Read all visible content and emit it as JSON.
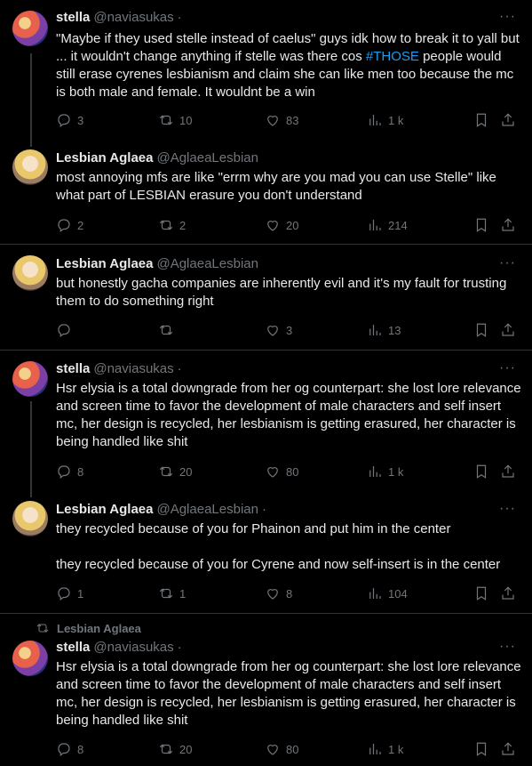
{
  "tweets": [
    {
      "name": "stella",
      "handle": "@naviasukas",
      "text_before": "\"Maybe if they used stelle instead of caelus\" guys idk how to break it to yall but ... it wouldn't change anything if stelle was there cos ",
      "hashtag": "#THOSE",
      "text_after": " people would still erase cyrenes lesbianism and claim she can like men too because the mc is both male and female. It wouldnt be a win",
      "replies": "3",
      "reposts": "10",
      "likes": "83",
      "views": "1 k"
    },
    {
      "name": "Lesbian Aglaea",
      "handle": "@AglaeaLesbian",
      "text": "most annoying mfs are like \"errm why are you mad you can use Stelle\" like what part of LESBIAN erasure you don't understand",
      "replies": "2",
      "reposts": "2",
      "likes": "20",
      "views": "214"
    },
    {
      "name": "Lesbian Aglaea",
      "handle": "@AglaeaLesbian",
      "text": "but honestly gacha companies are inherently evil and it's my fault for trusting them to do something right",
      "replies": "",
      "reposts": "",
      "likes": "3",
      "views": "13"
    },
    {
      "name": "stella",
      "handle": "@naviasukas",
      "text": "Hsr elysia is a total downgrade from her og counterpart: she lost lore relevance and screen time to favor the development of male characters and self insert mc, her design is recycled, her lesbianism is getting erasured, her character is being handled like shit",
      "replies": "8",
      "reposts": "20",
      "likes": "80",
      "views": "1 k"
    },
    {
      "name": "Lesbian Aglaea",
      "handle": "@AglaeaLesbian",
      "text": "they recycled because of you for Phainon and put him in the center\n\nthey recycled because of you for Cyrene and now self-insert is in the center",
      "replies": "1",
      "reposts": "1",
      "likes": "8",
      "views": "104"
    },
    {
      "repost_label": "Lesbian Aglaea",
      "name": "stella",
      "handle": "@naviasukas",
      "text": "Hsr elysia is a total downgrade from her og counterpart: she lost lore relevance and screen time to favor the development of male characters and self insert mc, her design is recycled, her lesbianism is getting erasured, her character is being handled like shit",
      "replies": "8",
      "reposts": "20",
      "likes": "80",
      "views": "1 k"
    }
  ],
  "dot": "·",
  "more": "···"
}
